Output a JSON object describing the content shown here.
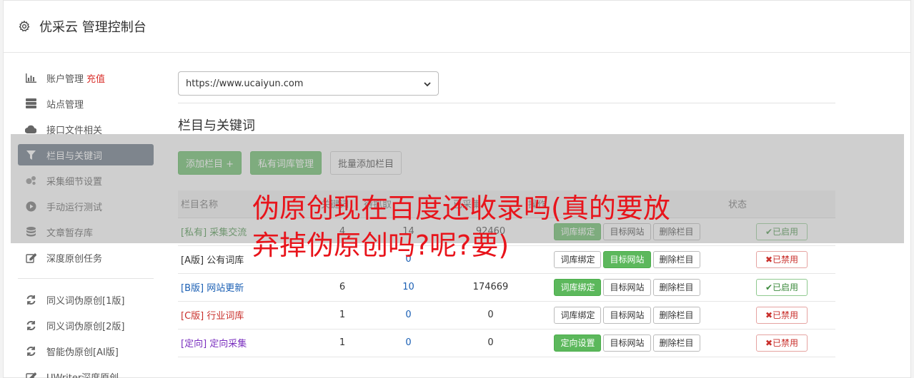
{
  "header": {
    "title": "优采云 管理控制台",
    "icon": "gear-icon"
  },
  "sidebar": {
    "items": [
      {
        "label": "账户管理",
        "extra": "充值",
        "icon": "bar-chart-icon"
      },
      {
        "label": "站点管理",
        "icon": "server-icon"
      },
      {
        "label": "接口文件相关",
        "icon": "cloud-upload-icon"
      },
      {
        "label": "栏目与关键词",
        "icon": "filter-icon",
        "active": true
      },
      {
        "label": "采集细节设置",
        "icon": "cogs-icon"
      },
      {
        "label": "手动运行测试",
        "icon": "play-circle-icon"
      },
      {
        "label": "文章暂存库",
        "icon": "database-icon"
      },
      {
        "label": "深度原创任务",
        "icon": "edit-icon"
      },
      {
        "label": "同义词伪原创[1版]",
        "icon": "refresh-icon"
      },
      {
        "label": "同义词伪原创[2版]",
        "icon": "refresh-icon"
      },
      {
        "label": "智能伪原创[AI版]",
        "icon": "refresh-icon"
      },
      {
        "label": "UWriter深度原创",
        "icon": "edit-icon"
      }
    ]
  },
  "main": {
    "site_select": "https://www.ucaiyun.com",
    "section_title": "栏目与关键词",
    "buttons": {
      "add_column": "添加栏目 +",
      "private_lib": "私有词库管理",
      "batch_add": "批量添加栏目"
    },
    "table": {
      "headers": [
        "栏目名称",
        "关键词",
        "待抓取",
        "已采集",
        "操作",
        "状态"
      ],
      "rows": [
        {
          "tag": "[私有]",
          "name": "采集交流",
          "kw": "4",
          "pending": "14",
          "collected": "92460",
          "op1": "词库绑定",
          "op2": "目标网站",
          "op3": "删除栏目",
          "status": "✔已启用"
        },
        {
          "tag": "[A版]",
          "name": "公有词库",
          "kw": "",
          "pending": "0",
          "collected": "",
          "op1": "词库绑定",
          "op2": "目标网站",
          "op3": "删除栏目",
          "status": "✖已禁用"
        },
        {
          "tag": "[B版]",
          "name": "网站更新",
          "kw": "6",
          "pending": "10",
          "collected": "174669",
          "op1": "词库绑定",
          "op2": "目标网站",
          "op3": "删除栏目",
          "status": "✔已启用"
        },
        {
          "tag": "[C版]",
          "name": "行业词库",
          "kw": "1",
          "pending": "0",
          "collected": "0",
          "op1": "词库绑定",
          "op2": "目标网站",
          "op3": "删除栏目",
          "status": "✖已禁用"
        },
        {
          "tag": "[定向]",
          "name": "定向采集",
          "kw": "1",
          "pending": "0",
          "collected": "0",
          "op1": "定向设置",
          "op2": "目标网站",
          "op3": "删除栏目",
          "status": "✖已禁用"
        }
      ]
    }
  },
  "overlay": {
    "headline": "伪原创现在百度还收录吗(真的要放弃掉伪原创吗?呢?要)"
  },
  "colors": {
    "green": "#5cb85c",
    "active_nav": "#5c6b7a",
    "headline": "#e8141b"
  }
}
